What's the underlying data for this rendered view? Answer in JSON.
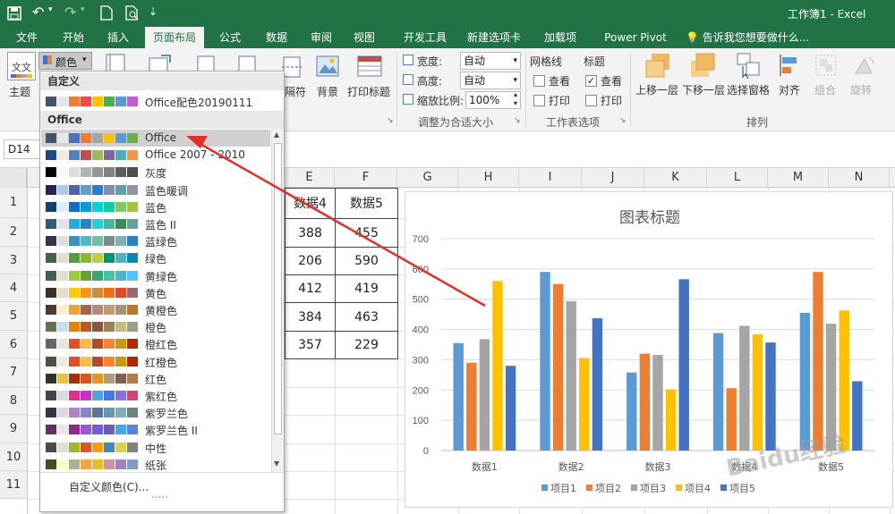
{
  "window": {
    "title": "工作簿1 - Excel"
  },
  "tabs": [
    {
      "label": "文件",
      "active": false
    },
    {
      "label": "开始",
      "active": false
    },
    {
      "label": "插入",
      "active": false
    },
    {
      "label": "页面布局",
      "active": true
    },
    {
      "label": "公式",
      "active": false
    },
    {
      "label": "数据",
      "active": false
    },
    {
      "label": "审阅",
      "active": false
    },
    {
      "label": "视图",
      "active": false
    },
    {
      "label": "开发工具",
      "active": false
    },
    {
      "label": "新建选项卡",
      "active": false
    },
    {
      "label": "加载项",
      "active": false
    },
    {
      "label": "Power Pivot",
      "active": false
    }
  ],
  "tell_me": "告诉我您想要做什么...",
  "ribbon": {
    "theme_label": "主题",
    "colors_label": "颜色",
    "breaks_label": "隔符",
    "background_label": "背景",
    "print_titles_label": "打印标题",
    "width_label": "宽度:",
    "width_value": "自动",
    "height_label": "高度:",
    "height_value": "自动",
    "scale_label": "缩放比例:",
    "scale_value": "100%",
    "scale_group": "调整为合适大小",
    "gridlines_label": "网格线",
    "headings_label": "标题",
    "view_label": "查看",
    "print_label": "打印",
    "gridlines_view": false,
    "gridlines_print": false,
    "headings_view": true,
    "headings_print": false,
    "sheet_options_group": "工作表选项",
    "bring_forward": "上移一层",
    "send_backward": "下移一层",
    "selection_pane": "选择窗格",
    "align": "对齐",
    "group": "组合",
    "rotate": "旋转",
    "arrange_group": "排列"
  },
  "namebox": "D14",
  "columns": [
    "E",
    "F",
    "G",
    "H",
    "I",
    "J",
    "K",
    "L",
    "M",
    "N"
  ],
  "rows": [
    "1",
    "2",
    "3",
    "4",
    "5",
    "6",
    "7",
    "8",
    "9",
    "10",
    "11"
  ],
  "table": {
    "headers": [
      "数据4",
      "数据5"
    ],
    "rows": [
      [
        "388",
        "455"
      ],
      [
        "206",
        "590"
      ],
      [
        "412",
        "419"
      ],
      [
        "384",
        "463"
      ],
      [
        "357",
        "229"
      ]
    ]
  },
  "dropdown": {
    "custom_header": "自定义",
    "custom_item": "Office配色20190111",
    "office_header": "Office",
    "items": [
      {
        "label": "Office",
        "colors": [
          "#44546a",
          "#e7e6e6",
          "#4472c4",
          "#ed7d31",
          "#a5a5a5",
          "#ffc000",
          "#5b9bd5",
          "#70ad47"
        ]
      },
      {
        "label": "Office 2007 - 2010",
        "colors": [
          "#1f497d",
          "#eeece1",
          "#4f81bd",
          "#c0504d",
          "#9bbb59",
          "#8064a2",
          "#4bacc6",
          "#f79646"
        ]
      },
      {
        "label": "灰度",
        "colors": [
          "#000000",
          "#f8f8f8",
          "#dddddd",
          "#b2b2b2",
          "#969696",
          "#808080",
          "#5f5f5f",
          "#4d4d4d"
        ]
      },
      {
        "label": "蓝色暖调",
        "colors": [
          "#242852",
          "#acccea",
          "#4a66ac",
          "#629dd1",
          "#297fd5",
          "#7f8fa9",
          "#5aa2ae",
          "#9d90a0"
        ]
      },
      {
        "label": "蓝色",
        "colors": [
          "#17406d",
          "#dbeff9",
          "#0f6fc6",
          "#009dd9",
          "#0bd0d9",
          "#10cf9b",
          "#7cca62",
          "#a5c249"
        ]
      },
      {
        "label": "蓝色 II",
        "colors": [
          "#335b74",
          "#dfe3e5",
          "#1cade4",
          "#2683c6",
          "#27ced7",
          "#42ba97",
          "#3e8853",
          "#62a39f"
        ]
      },
      {
        "label": "蓝绿色",
        "colors": [
          "#373545",
          "#dedede",
          "#3494ba",
          "#58b6c0",
          "#75bda7",
          "#7a8c8e",
          "#84acb6",
          "#2683c6"
        ]
      },
      {
        "label": "绿色",
        "colors": [
          "#455f51",
          "#e3ded1",
          "#549e39",
          "#8ab833",
          "#c0cf3a",
          "#029676",
          "#4ab5c4",
          "#0989b1"
        ]
      },
      {
        "label": "黄绿色",
        "colors": [
          "#455f51",
          "#e3ded1",
          "#99cb38",
          "#63a537",
          "#37a76f",
          "#44c1a3",
          "#4eb3cf",
          "#51c3f9"
        ]
      },
      {
        "label": "黄色",
        "colors": [
          "#39302a",
          "#e5dec9",
          "#ffca08",
          "#f8931d",
          "#ce8d3e",
          "#ec7016",
          "#e64823",
          "#9c6a6a"
        ]
      },
      {
        "label": "黄橙色",
        "colors": [
          "#4e3b30",
          "#fbeec9",
          "#f0a22e",
          "#a5644e",
          "#b58b80",
          "#c3986d",
          "#a19574",
          "#c17529"
        ]
      },
      {
        "label": "橙色",
        "colors": [
          "#637052",
          "#ccddea",
          "#e48312",
          "#bd582c",
          "#865640",
          "#9b8357",
          "#c2bc80",
          "#94a088"
        ]
      },
      {
        "label": "橙红色",
        "colors": [
          "#696464",
          "#e9e5dc",
          "#e84c22",
          "#ffbd47",
          "#b64926",
          "#ff8427",
          "#cc9900",
          "#b22600"
        ]
      },
      {
        "label": "红橙色",
        "colors": [
          "#505046",
          "#eeece1",
          "#e84c22",
          "#ffbd47",
          "#b64926",
          "#ff8427",
          "#cc9900",
          "#b22600"
        ]
      },
      {
        "label": "红色",
        "colors": [
          "#323232",
          "#e5c243",
          "#a5300f",
          "#d55816",
          "#e19825",
          "#b19c7d",
          "#7f5f52",
          "#b27d49"
        ]
      },
      {
        "label": "紫红色",
        "colors": [
          "#454551",
          "#d8d9dc",
          "#e32d91",
          "#c830cc",
          "#4ea6dc",
          "#4775e7",
          "#8971e1",
          "#d54773"
        ]
      },
      {
        "label": "紫罗兰色",
        "colors": [
          "#373545",
          "#dcd8dc",
          "#ad84c6",
          "#8784c7",
          "#5d739a",
          "#6997af",
          "#84acb6",
          "#6f8183"
        ]
      },
      {
        "label": "紫罗兰色 II",
        "colors": [
          "#632e62",
          "#eae5eb",
          "#92278f",
          "#9b57d3",
          "#755dd9",
          "#665eb8",
          "#45a5ed",
          "#5982db"
        ]
      },
      {
        "label": "中性",
        "colors": [
          "#4b4b4b",
          "#e3ded1",
          "#a6b727",
          "#df5327",
          "#fe9e00",
          "#418ab3",
          "#d7d447",
          "#818183"
        ]
      },
      {
        "label": "纸张",
        "colors": [
          "#444d26",
          "#fefac9",
          "#a5b592",
          "#f3a447",
          "#e7bc29",
          "#d092a7",
          "#9c85c0",
          "#809ec2"
        ]
      }
    ],
    "footer": "自定义颜色(C)...",
    "more": "....."
  },
  "chart_data": {
    "type": "bar",
    "title": "图表标题",
    "categories": [
      "数据1",
      "数据2",
      "数据3",
      "数据4",
      "数据5"
    ],
    "series": [
      {
        "name": "项目1",
        "values": [
          355,
          590,
          258,
          388,
          455
        ],
        "color": "#5b9bd5"
      },
      {
        "name": "项目2",
        "values": [
          290,
          550,
          320,
          206,
          590
        ],
        "color": "#ed7d31"
      },
      {
        "name": "项目3",
        "values": [
          368,
          493,
          316,
          412,
          419
        ],
        "color": "#a5a5a5"
      },
      {
        "name": "项目4",
        "values": [
          560,
          306,
          202,
          384,
          463
        ],
        "color": "#ffc000"
      },
      {
        "name": "项目5",
        "values": [
          280,
          437,
          566,
          357,
          229
        ],
        "color": "#4472c4"
      }
    ],
    "yticks": [
      "0",
      "100",
      "200",
      "300",
      "400",
      "500",
      "600",
      "700"
    ],
    "ylim": [
      0,
      700
    ],
    "grid": true,
    "legend": "bottom"
  },
  "watermark": "Baidu经验",
  "annotation_arrow_color": "#e0302a"
}
